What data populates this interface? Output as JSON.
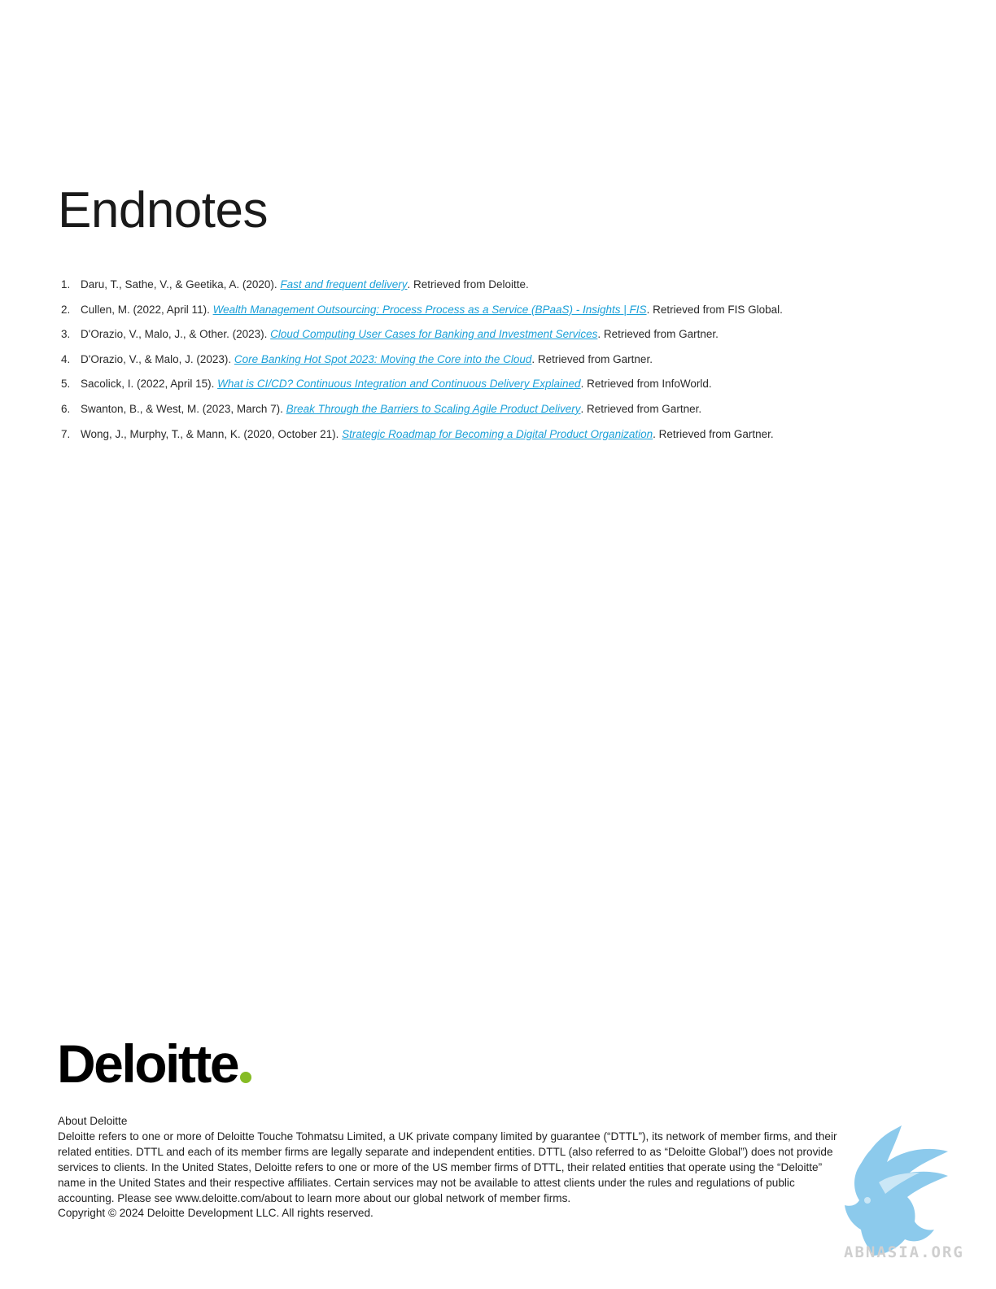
{
  "page": {
    "title": "Endnotes"
  },
  "endnotes": [
    {
      "num": "1.",
      "before": "Daru, T., Sathe, V., & Geetika, A. (2020). ",
      "link": "Fast and frequent delivery",
      "after": ". Retrieved from Deloitte."
    },
    {
      "num": "2.",
      "before": "Cullen, M. (2022, April 11). ",
      "link": "Wealth Management Outsourcing: Process Process as a Service (BPaaS) - Insights | FIS",
      "after": ". Retrieved from FIS Global."
    },
    {
      "num": "3.",
      "before": "D'Orazio, V., Malo, J., & Other. (2023). ",
      "link": "Cloud Computing User Cases for Banking and Investment Services",
      "after": ". Retrieved from Gartner."
    },
    {
      "num": "4.",
      "before": "D'Orazio, V., & Malo, J. (2023). ",
      "link": "Core Banking Hot Spot 2023: Moving the Core into the Cloud",
      "after": ". Retrieved from Gartner."
    },
    {
      "num": "5.",
      "before": "Sacolick, I. (2022, April 15). ",
      "link": "What is CI/CD? Continuous Integration and Continuous Delivery Explained",
      "after": ". Retrieved from InfoWorld."
    },
    {
      "num": "6.",
      "before": "Swanton, B., & West, M. (2023, March 7). ",
      "link": "Break Through the Barriers to Scaling Agile Product Delivery",
      "after": ". Retrieved from Gartner."
    },
    {
      "num": "7.",
      "before": "Wong, J., Murphy, T., & Mann, K. (2020, October 21). ",
      "link": "Strategic Roadmap for Becoming a Digital Product Organization",
      "after": ". Retrieved from Gartner."
    }
  ],
  "logo": {
    "text": "Deloitte",
    "dot_color": "#86bc25"
  },
  "about": {
    "heading": "About Deloitte",
    "body": "Deloitte refers to one or more of Deloitte Touche Tohmatsu Limited, a UK private company limited by guarantee (“DTTL”), its network of member firms, and their related entities. DTTL and each of its member firms are legally separate and independent entities. DTTL (also referred to as “Deloitte Global”) does not provide services to clients. In the United States, Deloitte refers to one or more of the US member firms of DTTL, their related entities that operate using the “Deloitte” name in the United States and their respective affiliates. Certain services may not be available to attest clients under the rules and regulations of public accounting. Please see www.deloitte.com/about to learn more about our global network of member firms.",
    "copyright": "Copyright © 2024 Deloitte Development LLC. All rights reserved."
  },
  "watermark": {
    "text": "ABNASIA.ORG",
    "color": "#7fc4ea"
  },
  "colors": {
    "link": "#1aa0d8",
    "text": "#2a2a2a"
  }
}
